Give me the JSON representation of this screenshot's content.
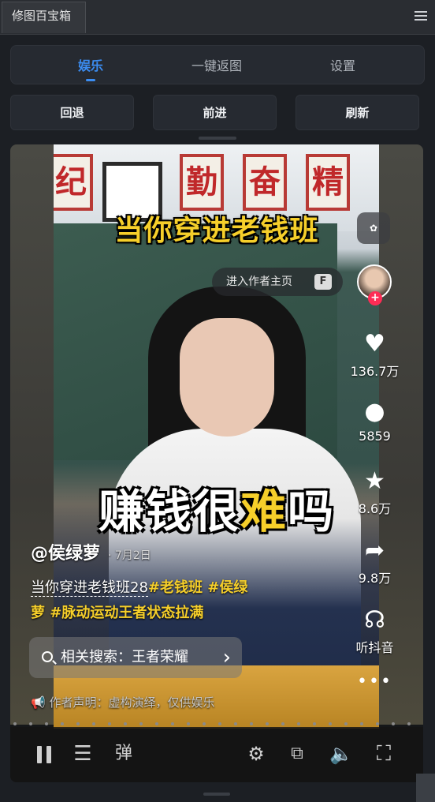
{
  "panel": {
    "title": "修图百宝箱",
    "menu_icon": "hamburger-icon"
  },
  "tabs": [
    {
      "label": "娱乐",
      "active": true
    },
    {
      "label": "一键返图",
      "active": false
    },
    {
      "label": "设置",
      "active": false
    }
  ],
  "nav": {
    "back": "回退",
    "forward": "前进",
    "refresh": "刷新"
  },
  "video": {
    "caption_top": "当你穿进老钱班",
    "caption_main_pre": "赚钱很",
    "caption_main_hl": "难",
    "caption_main_post": "吗",
    "author_pill": "进入作者主页",
    "author_key": "F",
    "ai_icon": "ai-flower-icon",
    "rail": {
      "likes": "136.7万",
      "comments": "5859",
      "favorites": "8.6万",
      "shares": "9.8万",
      "listen": "听抖音"
    },
    "username": "@侯绿萝",
    "date": "· 7月2日",
    "desc_plain": "当你穿进老钱班28",
    "desc_tags_1": "#老钱班 #侯绿",
    "desc_tags_2": "萝 #脉动运动王者状态拉满",
    "search_label": "相关搜索：王者荣耀",
    "disclaimer": "作者声明：虚构演绎，仅供娱乐",
    "controls": {
      "danmu": "弹"
    }
  },
  "colors": {
    "accent": "#3b8df2",
    "caption_yellow": "#f6cf2a",
    "like_red": "#fe2c55"
  }
}
